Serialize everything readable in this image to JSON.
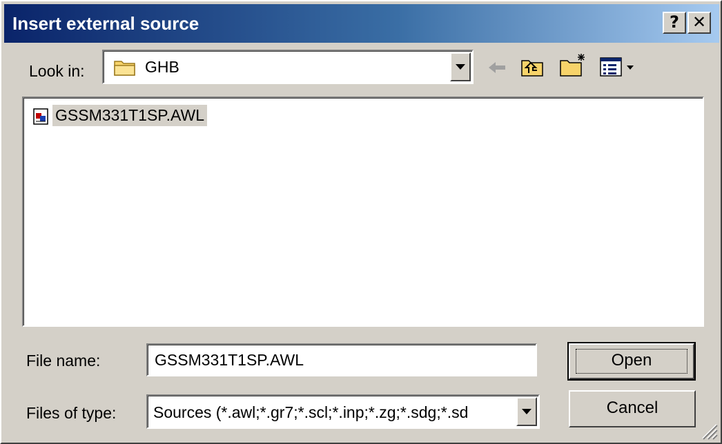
{
  "title": "Insert external source",
  "title_buttons": {
    "help": "?",
    "close": "✕"
  },
  "look_in": {
    "label": "Look in:",
    "value": "GHB"
  },
  "files": [
    {
      "name": "GSSM331T1SP.AWL",
      "icon": "awl-file-icon"
    }
  ],
  "file_name": {
    "label": "File name:",
    "value": "GSSM331T1SP.AWL"
  },
  "files_of_type": {
    "label": "Files of type:",
    "value": "Sources (*.awl;*.gr7;*.scl;*.inp;*.zg;*.sdg;*.sd"
  },
  "buttons": {
    "open": "Open",
    "cancel": "Cancel"
  },
  "colors": {
    "title_start": "#0a246a",
    "title_end": "#a6caf0",
    "face": "#d4d0c8"
  }
}
